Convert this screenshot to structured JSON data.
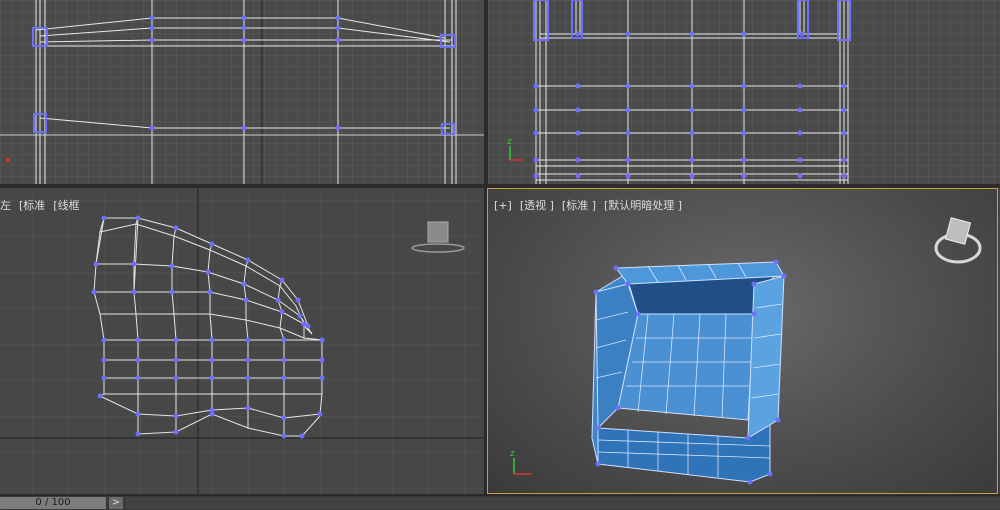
{
  "viewports": {
    "left": {
      "labels": [
        "左",
        "[标准",
        "[线框"
      ]
    },
    "perspective": {
      "labels": [
        "[+]",
        "[透视 ]",
        "[标准 ]",
        "[默认明暗处理 ]"
      ]
    }
  },
  "timeline": {
    "counter": "0 / 100",
    "next_label": ">"
  },
  "colors": {
    "grid": "#6a6a6a",
    "wire": "#e8e8e8",
    "vertex": "#6f6fff",
    "active": "#c8a13e",
    "model_blue": "#3f86c8"
  }
}
